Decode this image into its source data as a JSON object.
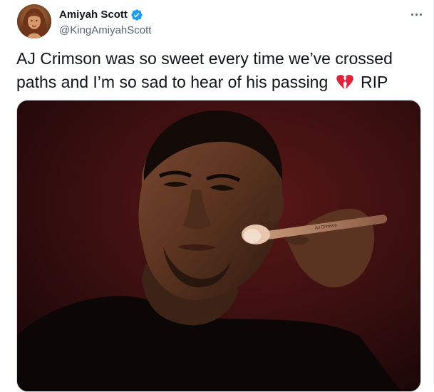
{
  "tweet": {
    "author": {
      "display_name": "Amiyah Scott",
      "handle": "@KingAmiyahScott",
      "verified": true
    },
    "text_before_emoji": "AJ Crimson was so sweet every time we’ve crossed paths and I’m so sad to hear of his passing",
    "emoji": "broken-heart-icon",
    "text_after_emoji": "RIP",
    "media": {
      "brush_label": "AJ Crimson"
    }
  },
  "colors": {
    "verified_blue": "#1d9bf0",
    "text_primary": "#0f1419",
    "text_secondary": "#536471",
    "broken_heart": "#e0243a"
  }
}
